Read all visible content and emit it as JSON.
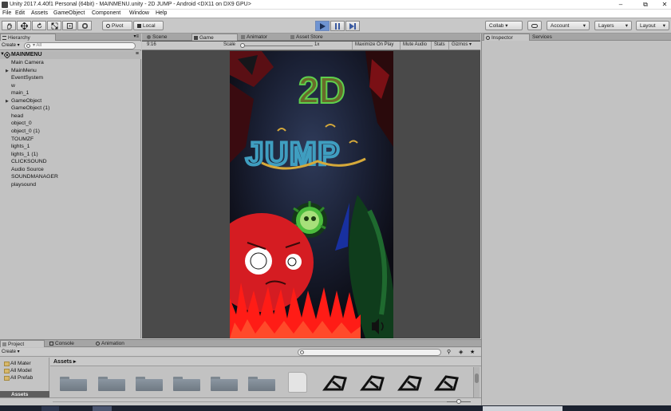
{
  "window": {
    "title": "Unity 2017.4.40f1 Personal (64bit) - MAINMENU.unity - 2D JUMP - Android <DX11 on DX9 GPU>",
    "minimize": "–",
    "maximize": "⧉",
    "close": "✕"
  },
  "menu": [
    "File",
    "Edit",
    "Assets",
    "GameObject",
    "Component",
    "Window",
    "Help"
  ],
  "toolbar": {
    "pivot": "Pivot",
    "local": "Local",
    "collab": "Collab ▾",
    "account": "Account",
    "layers": "Layers",
    "layout": "Layout"
  },
  "hierarchy": {
    "tab": "Hierarchy",
    "create": "Create ▾",
    "search_placeholder": "▾ All",
    "scene": "MAINMENU",
    "items": [
      {
        "label": "Main Camera",
        "arrow": ""
      },
      {
        "label": "MainMenu",
        "arrow": "▶"
      },
      {
        "label": "EventSystem",
        "arrow": ""
      },
      {
        "label": "w",
        "arrow": ""
      },
      {
        "label": "main_1",
        "arrow": ""
      },
      {
        "label": "GameObject",
        "arrow": "▶"
      },
      {
        "label": "GameObject (1)",
        "arrow": ""
      },
      {
        "label": "head",
        "arrow": ""
      },
      {
        "label": "object_0",
        "arrow": ""
      },
      {
        "label": "object_0 (1)",
        "arrow": ""
      },
      {
        "label": "TOUMZF",
        "arrow": ""
      },
      {
        "label": "lights_1",
        "arrow": ""
      },
      {
        "label": "lights_1 (1)",
        "arrow": ""
      },
      {
        "label": "CLICKSOUND",
        "arrow": ""
      },
      {
        "label": "Audio Source",
        "arrow": ""
      },
      {
        "label": "SOUNDMANAGER",
        "arrow": ""
      },
      {
        "label": "playsound",
        "arrow": ""
      }
    ]
  },
  "center_tabs": [
    "Scene",
    "Game",
    "Animator",
    "Asset Store"
  ],
  "game": {
    "aspect": "9:16",
    "scale_label": "Scale",
    "scale_value": "1x",
    "buttons": [
      "Maximize On Play",
      "Mute Audio",
      "Stats",
      "Gizmos ▾"
    ],
    "screen_title_1": "2D",
    "screen_title_2": "JUMP"
  },
  "inspector": {
    "tabs": [
      "Inspector",
      "Services"
    ]
  },
  "project": {
    "tabs": [
      "Project",
      "Console",
      "Animation"
    ],
    "create": "Create ▾",
    "tree": [
      "All Mater",
      "All Model",
      "All Prefab"
    ],
    "assets_root": "Assets",
    "breadcrumb": "Assets ▸"
  },
  "colors": {
    "editor_bg": "#c2c2c2",
    "play_active": "#6f94d2",
    "game_bg": "#4a4a4a"
  }
}
